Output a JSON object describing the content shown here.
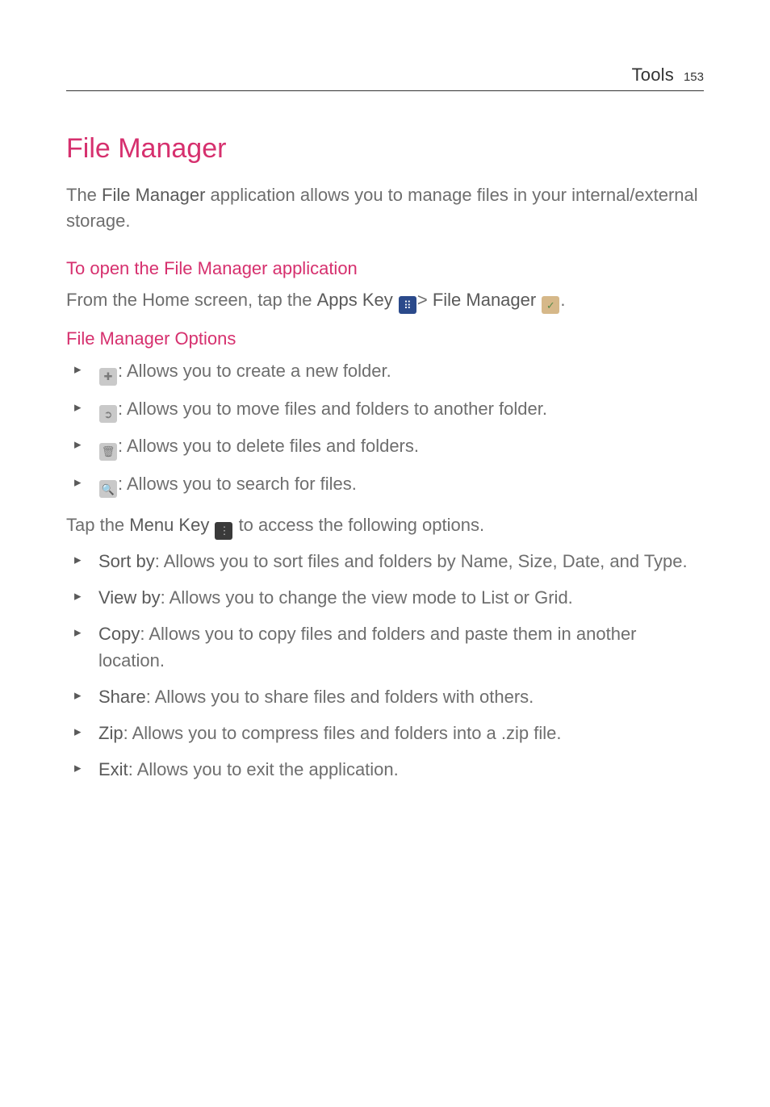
{
  "header": {
    "section": "Tools",
    "page_number": "153"
  },
  "title": "File Manager",
  "intro": {
    "prefix": "The ",
    "bold": "File Manager",
    "suffix": " application allows you to manage files in your internal/external storage."
  },
  "open_section": {
    "heading": "To open the File Manager application",
    "line_prefix": "From the Home screen, tap the ",
    "apps_key_label": "Apps Key ",
    "gt": "> ",
    "fm_label": "File Manager ",
    "period": "."
  },
  "options_section": {
    "heading": "File Manager Options",
    "icon_items": [
      {
        "desc": ": Allows you to create a new folder."
      },
      {
        "desc": ": Allows you to move files and folders to another folder."
      },
      {
        "desc": ": Allows you to delete files and folders."
      },
      {
        "desc": ": Allows you to search for files."
      }
    ],
    "menu_line": {
      "prefix": "Tap the ",
      "menu_key_label": "Menu Key ",
      "suffix": " to access the following options."
    },
    "menu_items": [
      {
        "name": "Sort by",
        "desc": ": Allows you to sort files and folders by Name, Size, Date, and Type."
      },
      {
        "name": "View by",
        "desc": ": Allows you to change the view mode to List or Grid."
      },
      {
        "name": "Copy",
        "desc": ": Allows you to copy files and folders  and paste them in another location."
      },
      {
        "name": "Share",
        "desc": ": Allows you to share files and folders with others."
      },
      {
        "name": "Zip",
        "desc": ": Allows you to compress files and folders into a .zip file."
      },
      {
        "name": "Exit",
        "desc": ": Allows you to exit the application."
      }
    ]
  },
  "icons": {
    "apps_key": "⠿",
    "file_manager": "✓",
    "new_folder": "✚",
    "move": "➲",
    "delete": "🗑",
    "search": "🔍",
    "menu": "⋮"
  }
}
